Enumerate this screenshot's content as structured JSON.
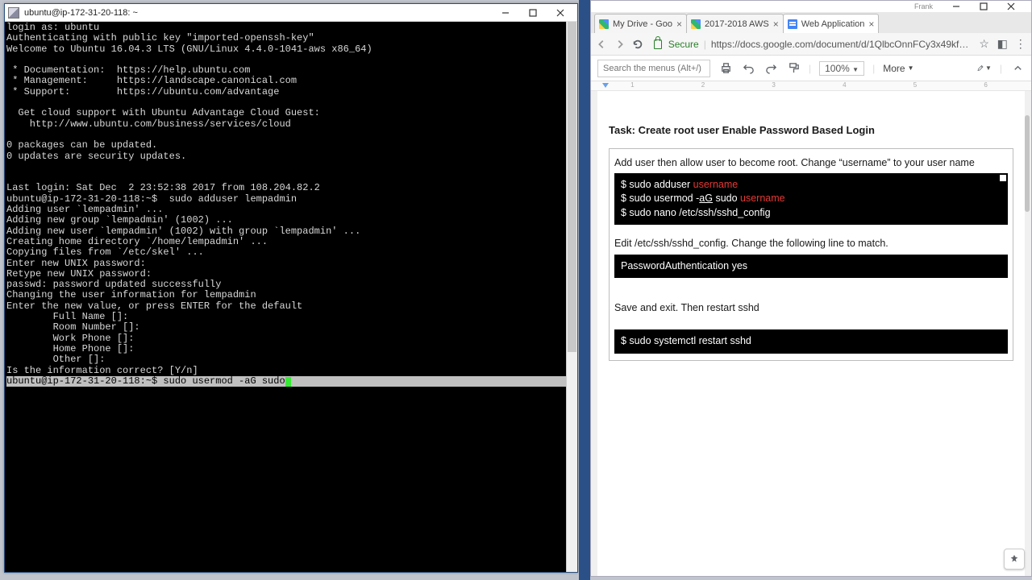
{
  "putty": {
    "title": "ubuntu@ip-172-31-20-118: ~",
    "lines": [
      "login as: ubuntu",
      "Authenticating with public key \"imported-openssh-key\"",
      "Welcome to Ubuntu 16.04.3 LTS (GNU/Linux 4.4.0-1041-aws x86_64)",
      "",
      " * Documentation:  https://help.ubuntu.com",
      " * Management:     https://landscape.canonical.com",
      " * Support:        https://ubuntu.com/advantage",
      "",
      "  Get cloud support with Ubuntu Advantage Cloud Guest:",
      "    http://www.ubuntu.com/business/services/cloud",
      "",
      "0 packages can be updated.",
      "0 updates are security updates.",
      "",
      "",
      "Last login: Sat Dec  2 23:52:38 2017 from 108.204.82.2",
      "ubuntu@ip-172-31-20-118:~$  sudo adduser lempadmin",
      "Adding user `lempadmin' ...",
      "Adding new group `lempadmin' (1002) ...",
      "Adding new user `lempadmin' (1002) with group `lempadmin' ...",
      "Creating home directory `/home/lempadmin' ...",
      "Copying files from `/etc/skel' ...",
      "Enter new UNIX password:",
      "Retype new UNIX password:",
      "passwd: password updated successfully",
      "Changing the user information for lempadmin",
      "Enter the new value, or press ENTER for the default",
      "        Full Name []:",
      "        Room Number []:",
      "        Work Phone []:",
      "        Home Phone []:",
      "        Other []:",
      "Is the information correct? [Y/n]"
    ],
    "prompt_line": "ubuntu@ip-172-31-20-118:~$ sudo usermod -aG sudo"
  },
  "chrome": {
    "frank": "Frank",
    "tabs": [
      {
        "label": "My Drive - Goo",
        "active": false,
        "favicon": "drive"
      },
      {
        "label": "2017-2018 AWS",
        "active": false,
        "favicon": "drive"
      },
      {
        "label": "Web Application",
        "active": true,
        "favicon": "docs"
      }
    ],
    "secure": "Secure",
    "url": "https://docs.google.com/document/d/1QlbcOnnFCy3x49kf…",
    "search_placeholder": "Search the menus (Alt+/)",
    "zoom": "100%",
    "more": "More",
    "ruler": [
      "1",
      "2",
      "3",
      "4",
      "5",
      "6"
    ]
  },
  "doc": {
    "task_title": "Task: Create root user Enable Password Based Login",
    "instr1": "Add user then allow user to become root. Change “username” to your user name",
    "code1_prefix_a": "$ sudo adduser ",
    "code1_user_a": "username",
    "code1_prefix_b": "$ sudo usermod -",
    "code1_flag_b": "aG",
    "code1_mid_b": " sudo ",
    "code1_user_b": "username",
    "code1_c": "$ sudo nano /etc/ssh/sshd_config",
    "instr2": "Edit /etc/ssh/sshd_config. Change the following line to match.",
    "code2": "PasswordAuthentication yes",
    "instr3": "Save and exit. Then restart sshd",
    "code3": "$ sudo systemctl restart sshd"
  }
}
